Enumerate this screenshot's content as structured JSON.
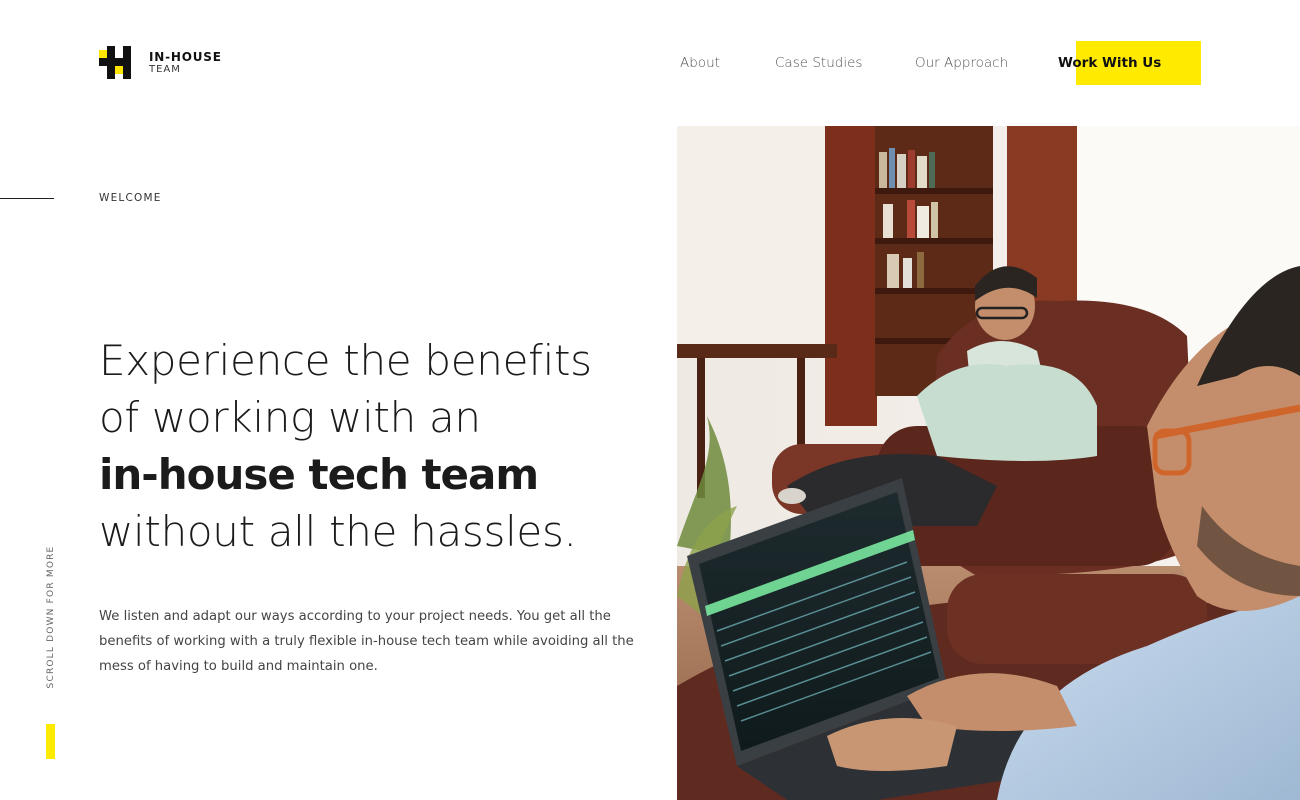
{
  "brand": {
    "name_line1": "IN-HOUSE",
    "name_line2": "TEAM",
    "accent_color": "#ffea00"
  },
  "nav": {
    "items": [
      {
        "label": "About"
      },
      {
        "label": "Case Studies"
      },
      {
        "label": "Our Approach"
      }
    ],
    "cta_label": "Work With Us"
  },
  "hero": {
    "eyebrow": "WELCOME",
    "headline_line1": "Experience the benefits",
    "headline_line2": "of working with an",
    "headline_strong": "in-house tech team",
    "headline_line4": "without all the hassles.",
    "intro": "We listen and adapt our ways according to your project needs. You get all the benefits of working with a truly flexible in-house tech team while avoiding all the mess of having to build and maintain one."
  },
  "scroll_hint": "SCROLL DOWN FOR MORE"
}
